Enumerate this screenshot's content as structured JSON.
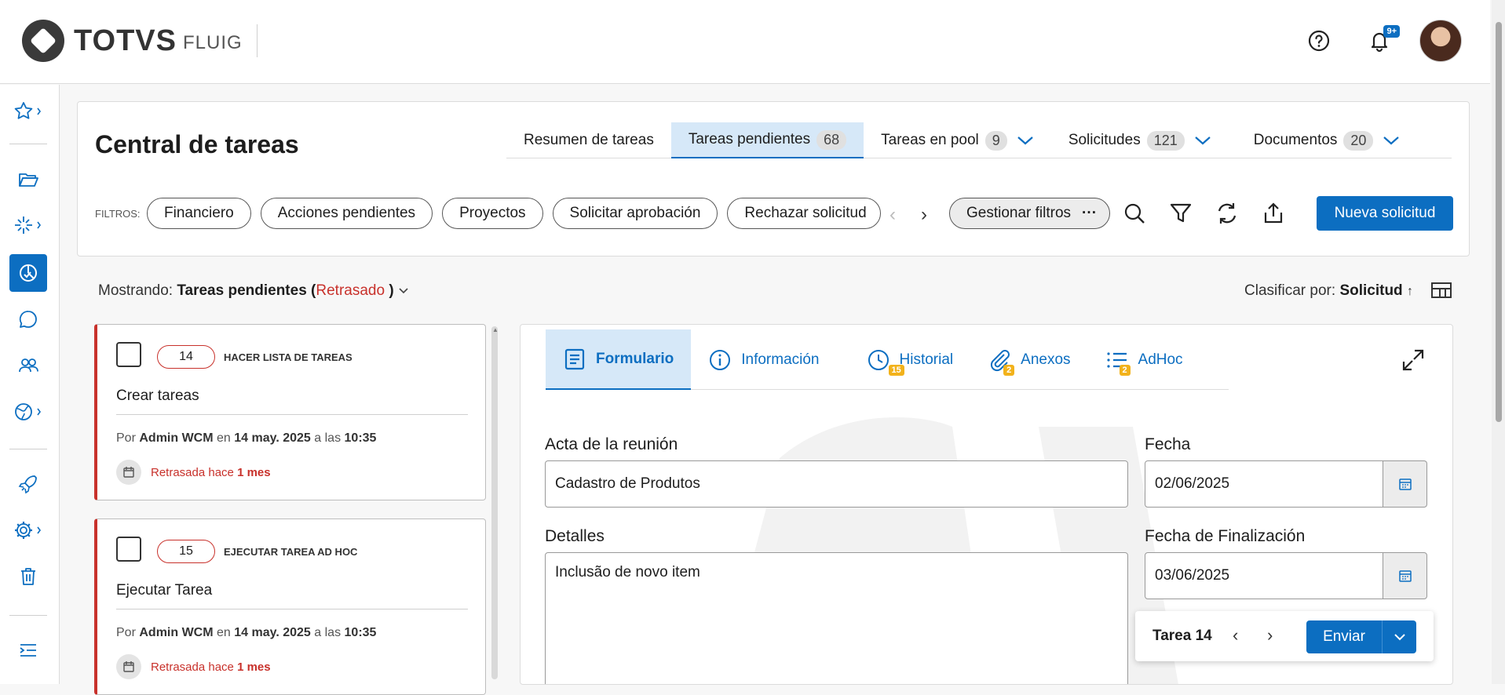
{
  "brand": {
    "name": "TOTVS",
    "product": "FLUIG"
  },
  "topbar": {
    "notifications_badge": "9+"
  },
  "page": {
    "title": "Central de tareas"
  },
  "tabs": [
    {
      "label": "Resumen de tareas",
      "count": ""
    },
    {
      "label": "Tareas pendientes",
      "count": "68"
    },
    {
      "label": "Tareas en pool",
      "count": "9"
    },
    {
      "label": "Solicitudes",
      "count": "121"
    },
    {
      "label": "Documentos",
      "count": "20"
    }
  ],
  "filters": {
    "label": "FILTROS:",
    "chips": [
      "Financiero",
      "Acciones pendientes",
      "Proyectos",
      "Solicitar aprobación",
      "Rechazar solicitud"
    ],
    "manage": "Gestionar filtros"
  },
  "actions": {
    "new_request": "Nueva solicitud"
  },
  "listing": {
    "prefix": "Mostrando:",
    "view": "Tareas pendientes (",
    "status": "Retrasado",
    "suffix": ")",
    "sort_label": "Clasificar por:",
    "sort_value": "Solicitud"
  },
  "tasks": [
    {
      "number": "14",
      "type": "HACER LISTA DE TAREAS",
      "name": "Crear tareas",
      "by": "Por",
      "author": "Admin WCM",
      "on": "en",
      "date": "14 may. 2025",
      "at": "a las",
      "time": "10:35",
      "late_prefix": "Retrasada hace",
      "late_value": "1 mes"
    },
    {
      "number": "15",
      "type": "EJECUTAR TAREA AD HOC",
      "name": "Ejecutar Tarea",
      "by": "Por",
      "author": "Admin WCM",
      "on": "en",
      "date": "14 may. 2025",
      "at": "a las",
      "time": "10:35",
      "late_prefix": "Retrasada hace",
      "late_value": "1 mes"
    }
  ],
  "detail_tabs": [
    {
      "label": "Formulario",
      "badge": ""
    },
    {
      "label": "Información",
      "badge": ""
    },
    {
      "label": "Historial",
      "badge": "15"
    },
    {
      "label": "Anexos",
      "badge": "2"
    },
    {
      "label": "AdHoc",
      "badge": "2"
    }
  ],
  "form": {
    "acta_label": "Acta de la reunión",
    "acta_value": "Cadastro de Produtos",
    "fecha_label": "Fecha",
    "fecha_value": "02/06/2025",
    "detalles_label": "Detalles",
    "detalles_value": "Inclusão de novo item",
    "fin_label": "Fecha de Finalización",
    "fin_value": "03/06/2025"
  },
  "task_nav": {
    "label": "Tarea 14",
    "send": "Enviar"
  },
  "colors": {
    "primary": "#0c6ec1",
    "danger": "#c8312b",
    "badge": "#f2b21b"
  }
}
